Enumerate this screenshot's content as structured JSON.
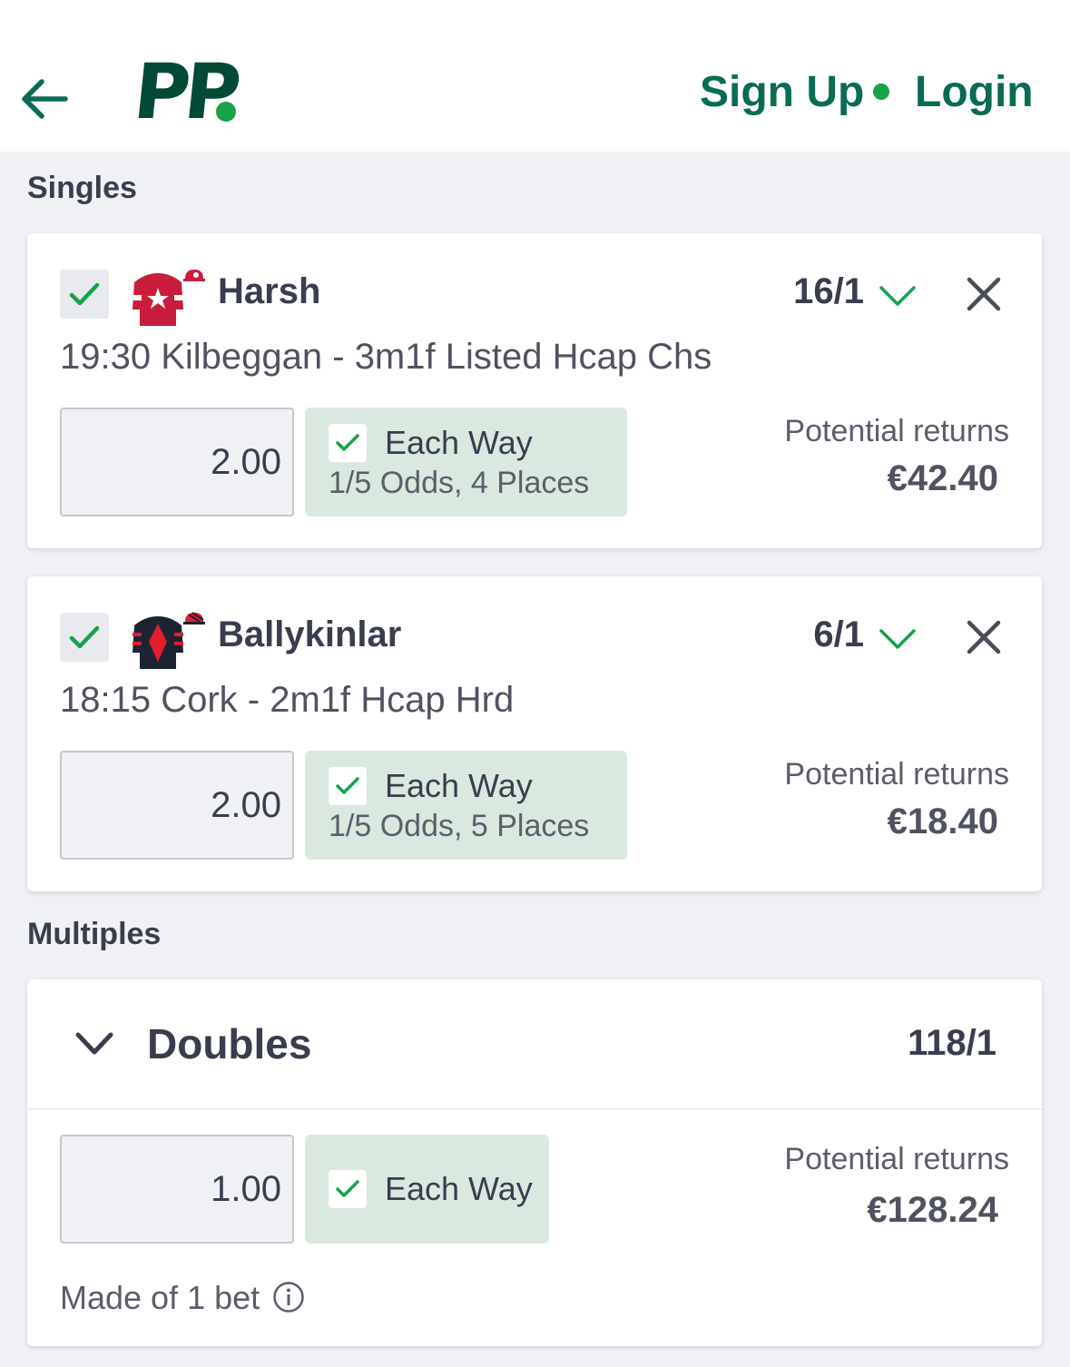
{
  "header": {
    "logo_text": "PP",
    "sign_up_label": "Sign Up",
    "login_label": "Login"
  },
  "sections": {
    "singles_title": "Singles",
    "multiples_title": "Multiples"
  },
  "singles": [
    {
      "selected": true,
      "horse": "Harsh",
      "silk_icon": "jockey-silk-red-star-icon",
      "odds": "16/1",
      "race": "19:30 Kilbeggan - 3m1f Listed Hcap Chs",
      "stake": "2.00",
      "each_way": {
        "checked": true,
        "label": "Each Way",
        "terms": "1/5 Odds, 4 Places"
      },
      "potential_returns_label": "Potential returns",
      "potential_returns": "€42.40"
    },
    {
      "selected": true,
      "horse": "Ballykinlar",
      "silk_icon": "jockey-silk-black-red-diamond-icon",
      "odds": "6/1",
      "race": "18:15 Cork - 2m1f Hcap Hrd",
      "stake": "2.00",
      "each_way": {
        "checked": true,
        "label": "Each Way",
        "terms": "1/5 Odds, 5 Places"
      },
      "potential_returns_label": "Potential returns",
      "potential_returns": "€18.40"
    }
  ],
  "multiples": {
    "doubles": {
      "title": "Doubles",
      "odds": "118/1",
      "stake": "1.00",
      "each_way": {
        "checked": true,
        "label": "Each Way"
      },
      "potential_returns_label": "Potential returns",
      "potential_returns": "€128.24",
      "made_of": "Made of 1 bet"
    }
  },
  "colors": {
    "brand_dark_green": "#024a35",
    "link_green": "#0a6b54",
    "accent_green": "#16a34a",
    "each_way_bg": "#dae9e0",
    "page_bg": "#f0f1f5"
  }
}
